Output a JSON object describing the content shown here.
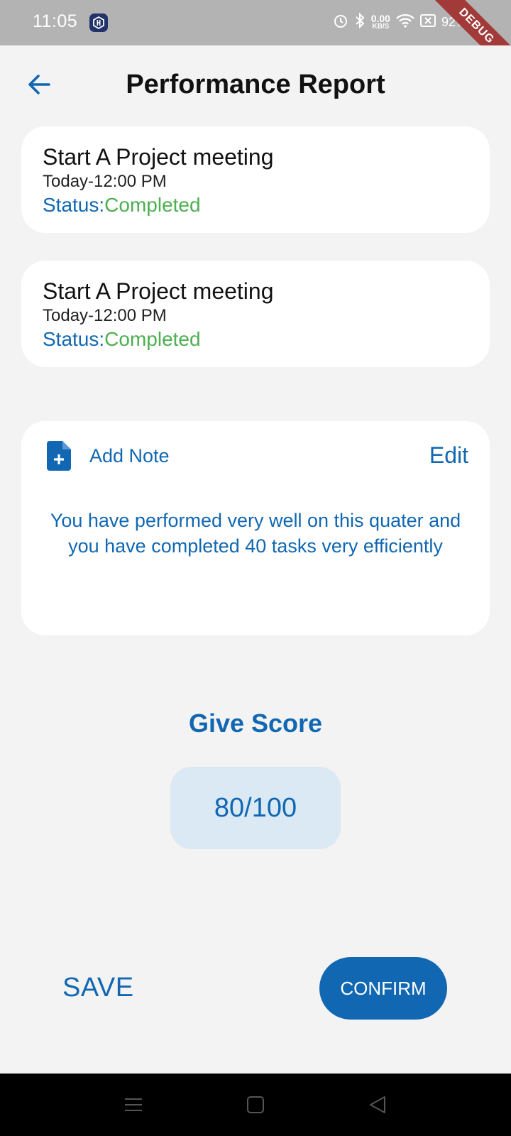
{
  "status_bar": {
    "time": "11:05",
    "speed_value": "0.00",
    "speed_unit": "KB/S",
    "battery": "92%",
    "debug_label": "DEBUG"
  },
  "header": {
    "title": "Performance Report",
    "back_icon": "arrow-left-icon"
  },
  "tasks": [
    {
      "title": "Start A Project meeting",
      "time": "Today-12:00 PM",
      "status_label": "Status:",
      "status_value": "Completed"
    },
    {
      "title": "Start A Project meeting",
      "time": "Today-12:00 PM",
      "status_label": "Status:",
      "status_value": "Completed"
    }
  ],
  "note": {
    "add_label": "Add Note",
    "edit_label": "Edit",
    "text": "You have performed very well on this quater and you have completed 40  tasks very efficiently"
  },
  "score": {
    "heading": "Give Score",
    "value": "80/100"
  },
  "actions": {
    "save_label": "SAVE",
    "confirm_label": "CONFIRM"
  },
  "colors": {
    "accent": "#1167b1",
    "success": "#4caf50",
    "background": "#f3f3f3",
    "score_bg": "#dbe9f4"
  }
}
